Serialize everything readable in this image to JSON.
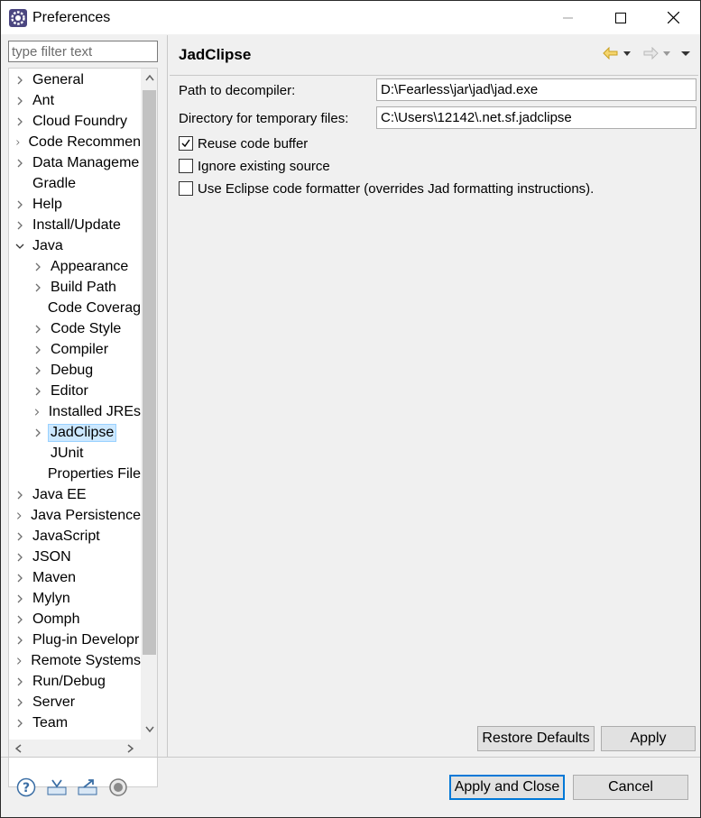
{
  "window": {
    "title": "Preferences",
    "icon": "eclipse-gear-icon",
    "controls": {
      "minimize": "minimize-icon",
      "maximize": "maximize-icon",
      "close": "close-icon"
    }
  },
  "filter": {
    "placeholder": "type filter text",
    "value": ""
  },
  "tree": {
    "items": [
      {
        "label": "General",
        "level": 0,
        "arrow": "collapsed"
      },
      {
        "label": "Ant",
        "level": 0,
        "arrow": "collapsed"
      },
      {
        "label": "Cloud Foundry",
        "level": 0,
        "arrow": "collapsed"
      },
      {
        "label": "Code Recommen",
        "level": 0,
        "arrow": "collapsed"
      },
      {
        "label": "Data Manageme",
        "level": 0,
        "arrow": "collapsed"
      },
      {
        "label": "Gradle",
        "level": 0,
        "arrow": "none"
      },
      {
        "label": "Help",
        "level": 0,
        "arrow": "collapsed"
      },
      {
        "label": "Install/Update",
        "level": 0,
        "arrow": "collapsed"
      },
      {
        "label": "Java",
        "level": 0,
        "arrow": "expanded"
      },
      {
        "label": "Appearance",
        "level": 1,
        "arrow": "collapsed"
      },
      {
        "label": "Build Path",
        "level": 1,
        "arrow": "collapsed"
      },
      {
        "label": "Code Coverag",
        "level": 1,
        "arrow": "none"
      },
      {
        "label": "Code Style",
        "level": 1,
        "arrow": "collapsed"
      },
      {
        "label": "Compiler",
        "level": 1,
        "arrow": "collapsed"
      },
      {
        "label": "Debug",
        "level": 1,
        "arrow": "collapsed"
      },
      {
        "label": "Editor",
        "level": 1,
        "arrow": "collapsed"
      },
      {
        "label": "Installed JREs",
        "level": 1,
        "arrow": "collapsed"
      },
      {
        "label": "JadClipse",
        "level": 1,
        "arrow": "collapsed",
        "selected": true
      },
      {
        "label": "JUnit",
        "level": 1,
        "arrow": "none"
      },
      {
        "label": "Properties File",
        "level": 1,
        "arrow": "none"
      },
      {
        "label": "Java EE",
        "level": 0,
        "arrow": "collapsed"
      },
      {
        "label": "Java Persistence",
        "level": 0,
        "arrow": "collapsed"
      },
      {
        "label": "JavaScript",
        "level": 0,
        "arrow": "collapsed"
      },
      {
        "label": "JSON",
        "level": 0,
        "arrow": "collapsed"
      },
      {
        "label": "Maven",
        "level": 0,
        "arrow": "collapsed"
      },
      {
        "label": "Mylyn",
        "level": 0,
        "arrow": "collapsed"
      },
      {
        "label": "Oomph",
        "level": 0,
        "arrow": "collapsed"
      },
      {
        "label": "Plug-in Developr",
        "level": 0,
        "arrow": "collapsed"
      },
      {
        "label": "Remote Systems",
        "level": 0,
        "arrow": "collapsed"
      },
      {
        "label": "Run/Debug",
        "level": 0,
        "arrow": "collapsed"
      },
      {
        "label": "Server",
        "level": 0,
        "arrow": "collapsed"
      },
      {
        "label": "Team",
        "level": 0,
        "arrow": "collapsed"
      }
    ]
  },
  "page": {
    "title": "JadClipse",
    "nav": {
      "back": "back-arrow-icon",
      "back_menu": "dropdown-icon",
      "forward": "forward-arrow-icon",
      "forward_menu": "dropdown-icon",
      "view_menu": "view-menu-icon"
    },
    "fields": [
      {
        "label": "Path to decompiler:",
        "value": "D:\\Fearless\\jar\\jad\\jad.exe"
      },
      {
        "label": "Directory for temporary files:",
        "value": "C:\\Users\\12142\\.net.sf.jadclipse"
      }
    ],
    "checkboxes": [
      {
        "label": "Reuse code buffer",
        "checked": true
      },
      {
        "label": "Ignore existing source",
        "checked": false
      },
      {
        "label": "Use Eclipse code formatter (overrides Jad formatting instructions).",
        "checked": false
      }
    ],
    "restore_defaults": "Restore Defaults",
    "apply": "Apply"
  },
  "footer": {
    "icons": [
      "help-icon",
      "import-icon",
      "export-icon",
      "record-icon"
    ],
    "apply_and_close": "Apply and Close",
    "cancel": "Cancel"
  }
}
